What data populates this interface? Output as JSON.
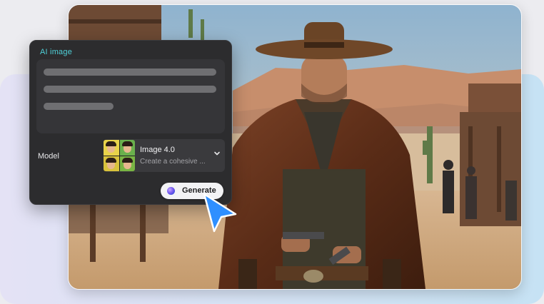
{
  "panel": {
    "title": "AI image",
    "model_label": "Model",
    "model": {
      "name": "Image 4.0",
      "description": "Create a cohesive ..."
    },
    "generate_label": "Generate"
  },
  "colors": {
    "panel_bg": "#2c2c2e",
    "title_accent": "#4fd1d9",
    "cursor_blue": "#2f8fff"
  },
  "icons": {
    "model_selector": "chevron-down-icon",
    "generate": "sparkle-orb-icon",
    "pointer": "mouse-cursor-icon"
  }
}
